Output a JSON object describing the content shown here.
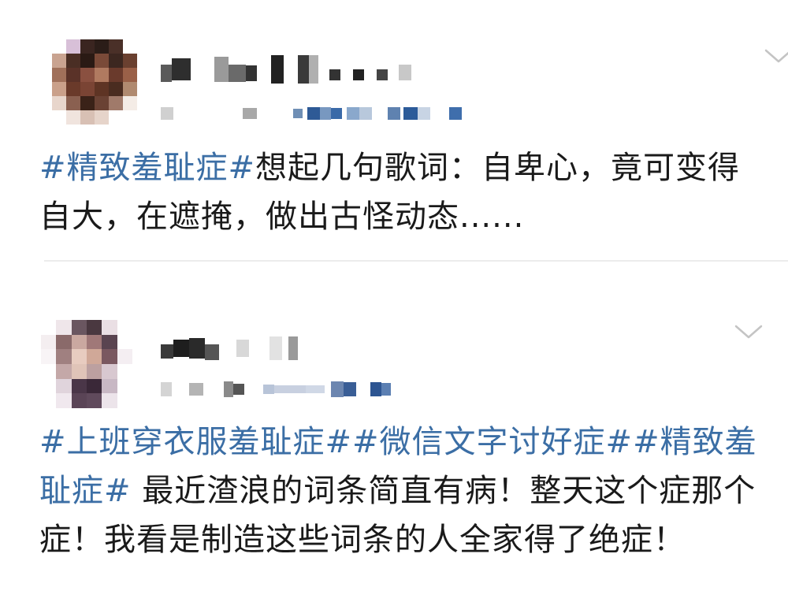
{
  "colors": {
    "topic": "#3b6ea5",
    "text": "#1a1a1a",
    "divider": "#ececec",
    "chevron": "#c4c4c4"
  },
  "posts": [
    {
      "topic": "#精致羞耻症#",
      "body": "想起几句歌词：自卑心，竟可变得自大，在遮掩，做出古怪动态......",
      "expand_icon": "chevron-down-icon"
    },
    {
      "topics": [
        "#上班穿衣服羞耻症#",
        "#微信文字讨好症#",
        "#精致羞耻症#"
      ],
      "body": " 最近渣浪的词条简直有病！整天这个症那个症！我看是制造这些词条的人全家得了绝症！",
      "expand_icon": "chevron-down-icon"
    }
  ]
}
